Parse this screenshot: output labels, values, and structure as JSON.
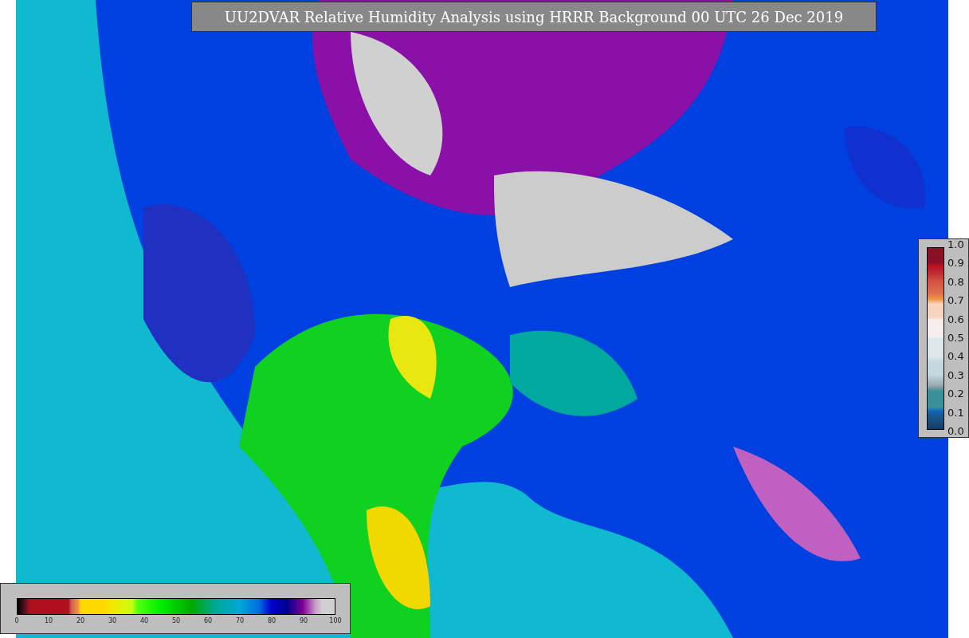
{
  "title": "UU2DVAR Relative Humidity Analysis using HRRR Background 00 UTC 26 Dec 2019",
  "ratio_colorbar": {
    "ticks": [
      "1.0",
      "0.9",
      "0.8",
      "0.7",
      "0.6",
      "0.5",
      "0.4",
      "0.3",
      "0.2",
      "0.1",
      "0.0"
    ]
  },
  "humidity_colorbar": {
    "ticks": [
      "0",
      "10",
      "20",
      "30",
      "40",
      "50",
      "60",
      "70",
      "80",
      "90",
      "100"
    ]
  }
}
